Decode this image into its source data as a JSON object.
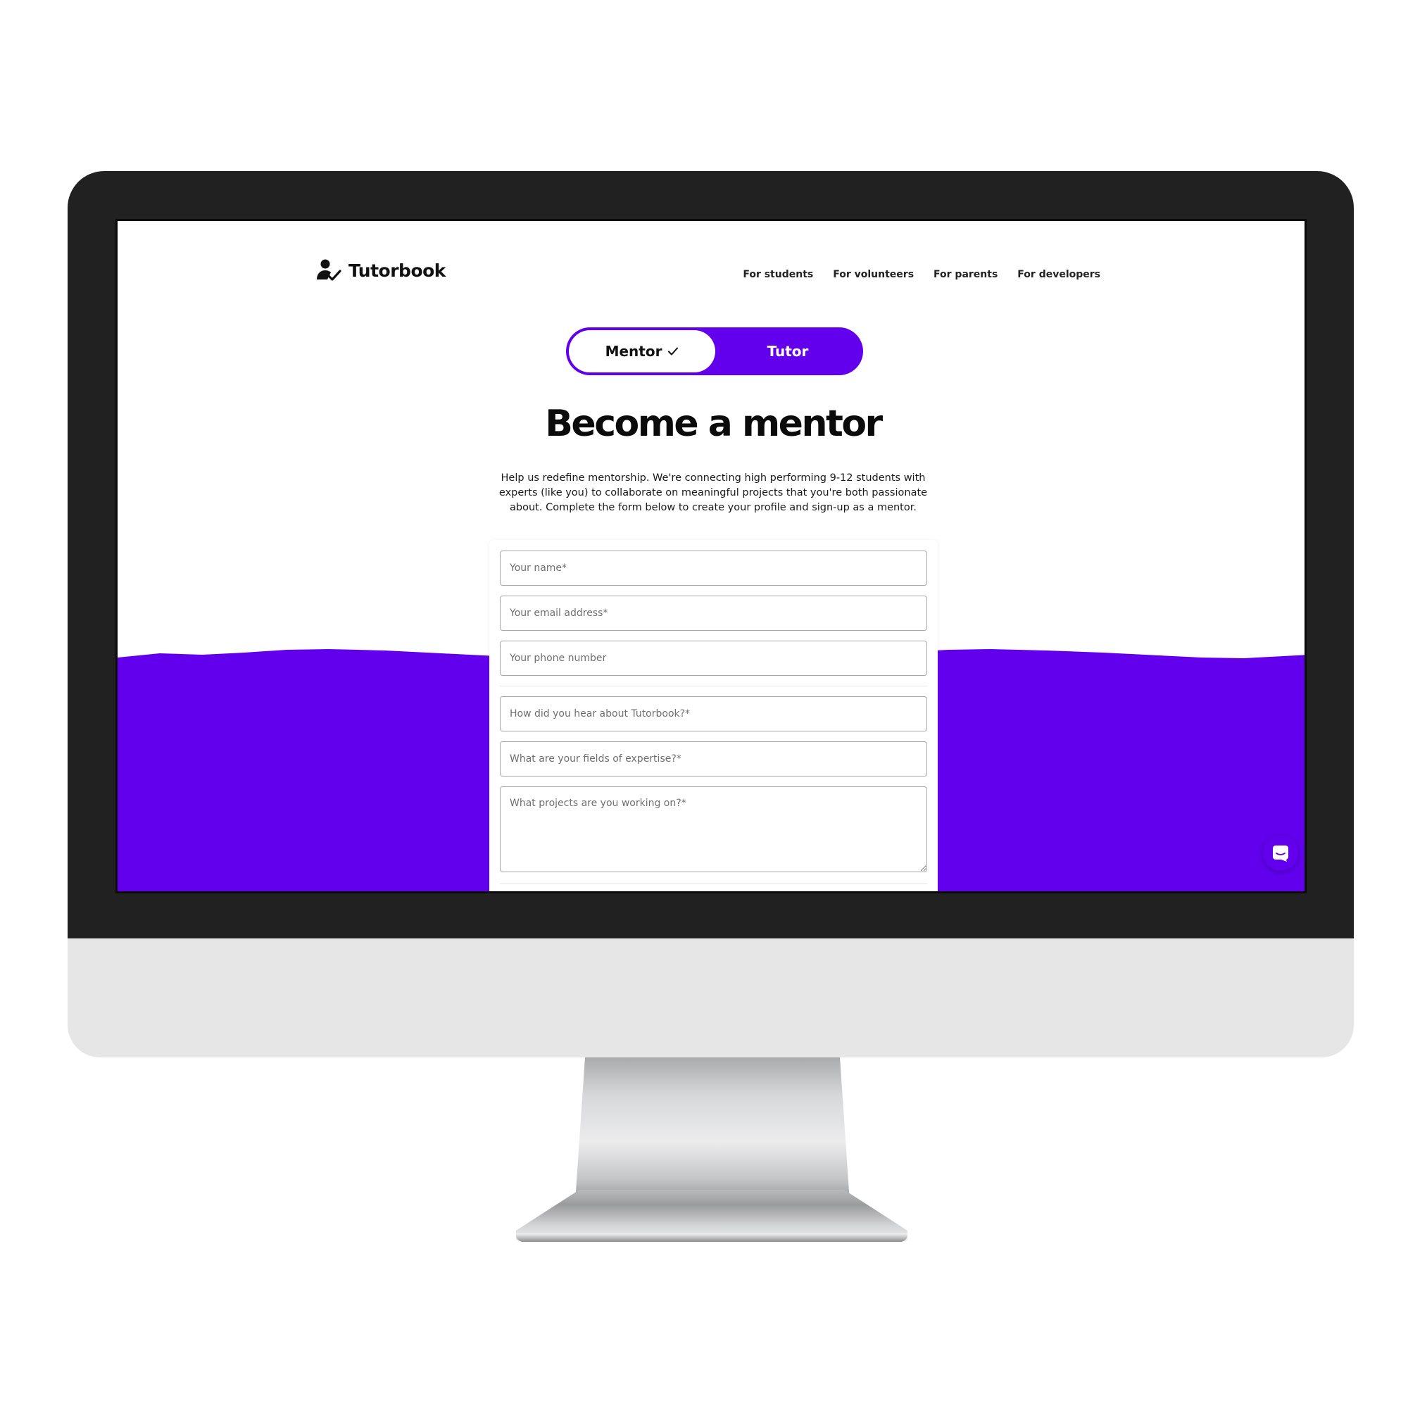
{
  "brand": {
    "name": "Tutorbook",
    "accent_color": "#6200ee",
    "logo_icon": "user-check-icon"
  },
  "nav": {
    "items": [
      {
        "label": "For students"
      },
      {
        "label": "For volunteers"
      },
      {
        "label": "For parents"
      },
      {
        "label": "For developers"
      }
    ]
  },
  "toggle": {
    "options": [
      {
        "label": "Mentor",
        "selected": true,
        "icon": "check-icon"
      },
      {
        "label": "Tutor",
        "selected": false
      }
    ]
  },
  "hero": {
    "title": "Become a mentor",
    "description": "Help us redefine mentorship. We're connecting high performing 9-12 students with experts (like you) to collaborate on meaningful projects that you're both passionate about. Complete the form below to create your profile and sign-up as a mentor."
  },
  "form": {
    "name_placeholder": "Your name*",
    "email_placeholder": "Your email address*",
    "phone_placeholder": "Your phone number",
    "referral_placeholder": "How did you hear about Tutorbook?*",
    "expertise_placeholder": "What are your fields of expertise?*",
    "projects_placeholder": "What projects are you working on?*"
  },
  "chat": {
    "icon": "chat-icon"
  }
}
